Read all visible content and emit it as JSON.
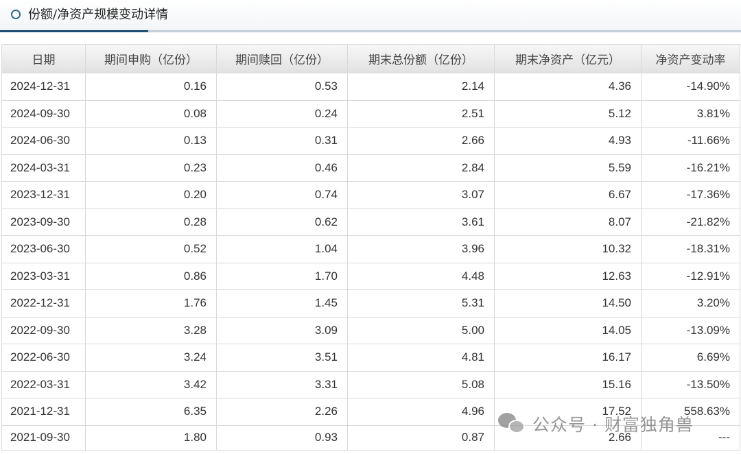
{
  "section": {
    "title": "份额/净资产规模变动详情"
  },
  "table": {
    "columns": [
      "日期",
      "期间申购（亿份）",
      "期间赎回（亿份）",
      "期末总份额（亿份）",
      "期末净资产（亿元）",
      "净资产变动率"
    ],
    "rows": [
      [
        "2024-12-31",
        "0.16",
        "0.53",
        "2.14",
        "4.36",
        "-14.90%"
      ],
      [
        "2024-09-30",
        "0.08",
        "0.24",
        "2.51",
        "5.12",
        "3.81%"
      ],
      [
        "2024-06-30",
        "0.13",
        "0.31",
        "2.66",
        "4.93",
        "-11.66%"
      ],
      [
        "2024-03-31",
        "0.23",
        "0.46",
        "2.84",
        "5.59",
        "-16.21%"
      ],
      [
        "2023-12-31",
        "0.20",
        "0.74",
        "3.07",
        "6.67",
        "-17.36%"
      ],
      [
        "2023-09-30",
        "0.28",
        "0.62",
        "3.61",
        "8.07",
        "-21.82%"
      ],
      [
        "2023-06-30",
        "0.52",
        "1.04",
        "3.96",
        "10.32",
        "-18.31%"
      ],
      [
        "2023-03-31",
        "0.86",
        "1.70",
        "4.48",
        "12.63",
        "-12.91%"
      ],
      [
        "2022-12-31",
        "1.76",
        "1.45",
        "5.31",
        "14.50",
        "3.20%"
      ],
      [
        "2022-09-30",
        "3.28",
        "3.09",
        "5.00",
        "14.05",
        "-13.09%"
      ],
      [
        "2022-06-30",
        "3.24",
        "3.51",
        "4.81",
        "16.17",
        "6.69%"
      ],
      [
        "2022-03-31",
        "3.42",
        "3.31",
        "5.08",
        "15.16",
        "-13.50%"
      ],
      [
        "2021-12-31",
        "6.35",
        "2.26",
        "4.96",
        "17.52",
        "558.63%"
      ],
      [
        "2021-09-30",
        "1.80",
        "0.93",
        "0.87",
        "2.66",
        "---"
      ]
    ]
  },
  "watermark": {
    "text": "公众号 · 财富独角兽"
  },
  "colors": {
    "accent_dark": "#1f4f74",
    "accent_light": "#c3d0dc",
    "bullet": "#2f6a95",
    "grid": "#d9d9d9"
  },
  "icons": {
    "section_bullet": "ring-bullet-icon",
    "watermark_logo": "wechat-icon"
  }
}
